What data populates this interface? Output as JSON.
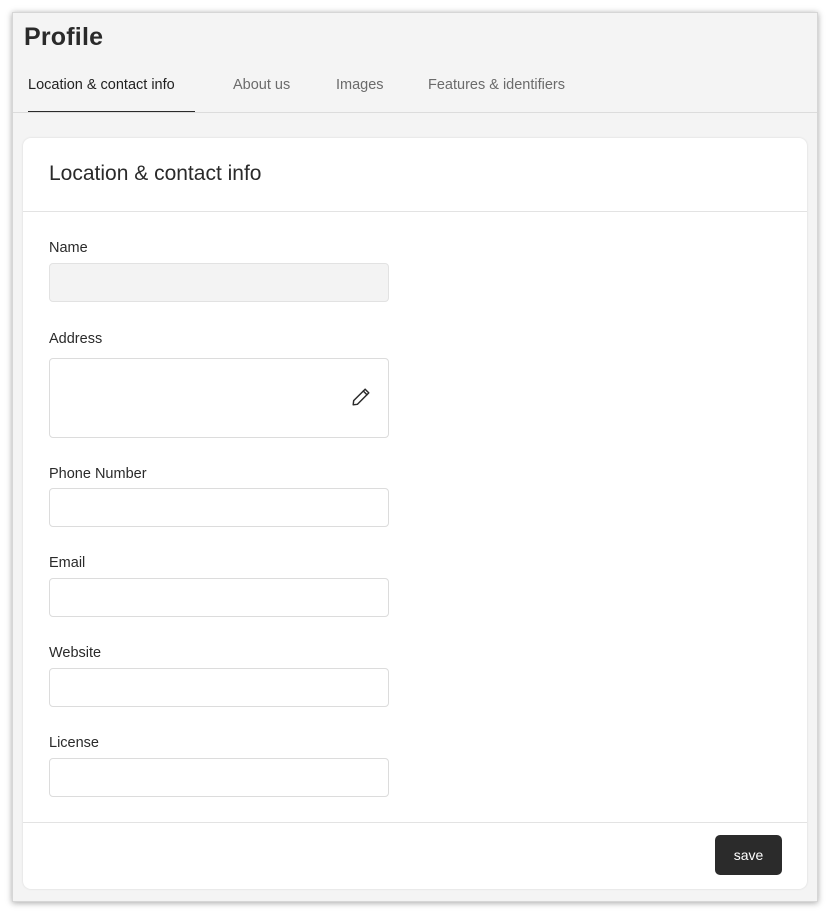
{
  "page": {
    "title": "Profile"
  },
  "tabs": [
    {
      "label": "Location & contact info",
      "active": true
    },
    {
      "label": "About us",
      "active": false
    },
    {
      "label": "Images",
      "active": false
    },
    {
      "label": "Features & identifiers",
      "active": false
    }
  ],
  "card": {
    "title": "Location & contact info",
    "fields": {
      "name": {
        "label": "Name",
        "value": ""
      },
      "address": {
        "label": "Address",
        "value": ""
      },
      "phone": {
        "label": "Phone Number",
        "value": ""
      },
      "email": {
        "label": "Email",
        "value": ""
      },
      "website": {
        "label": "Website",
        "value": ""
      },
      "license": {
        "label": "License",
        "value": ""
      }
    },
    "save_label": "save"
  },
  "icons": {
    "edit": "pencil-icon"
  },
  "colors": {
    "accent": "#2b2b2b",
    "background": "#f4f4f4",
    "card": "#ffffff"
  }
}
